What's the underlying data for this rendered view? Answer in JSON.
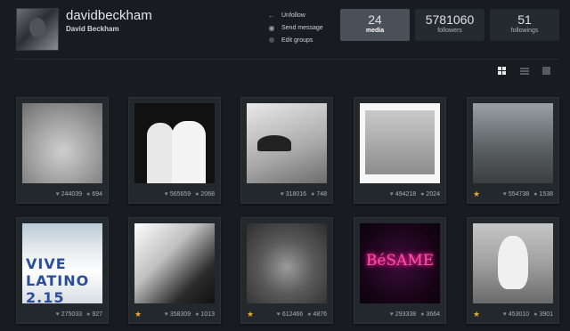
{
  "profile": {
    "username": "davidbeckham",
    "full_name": "David Beckham"
  },
  "actions": [
    {
      "label": "Unfollow",
      "icon": "back-arrow-icon"
    },
    {
      "label": "Send message",
      "icon": "speech-bubble-icon"
    },
    {
      "label": "Edit groups",
      "icon": "dot-icon"
    }
  ],
  "stats": {
    "media": {
      "value": "24",
      "label": "media"
    },
    "followers": {
      "value": "5781060",
      "label": "followers"
    },
    "followings": {
      "value": "51",
      "label": "followings"
    }
  },
  "view_modes": [
    "grid-view-icon",
    "list-view-icon",
    "single-view-icon"
  ],
  "colors": {
    "background": "#181c20",
    "card": "#23282d",
    "accent": "#3a9ad9",
    "star": "#e7a831"
  },
  "media": [
    {
      "likes": "244039",
      "comments": "694",
      "starred": false
    },
    {
      "likes": "565659",
      "comments": "2068",
      "starred": false
    },
    {
      "likes": "318016",
      "comments": "748",
      "starred": false
    },
    {
      "likes": "494218",
      "comments": "2024",
      "starred": false
    },
    {
      "likes": "554738",
      "comments": "1538",
      "starred": true
    },
    {
      "likes": "275033",
      "comments": "927",
      "starred": false,
      "photo_text": "VIVE LATINO 2.15"
    },
    {
      "likes": "358309",
      "comments": "1013",
      "starred": true
    },
    {
      "likes": "612466",
      "comments": "4876",
      "starred": true
    },
    {
      "likes": "293338",
      "comments": "3664",
      "starred": false,
      "photo_text": "BéSAME"
    },
    {
      "likes": "453010",
      "comments": "3901",
      "starred": true
    }
  ]
}
